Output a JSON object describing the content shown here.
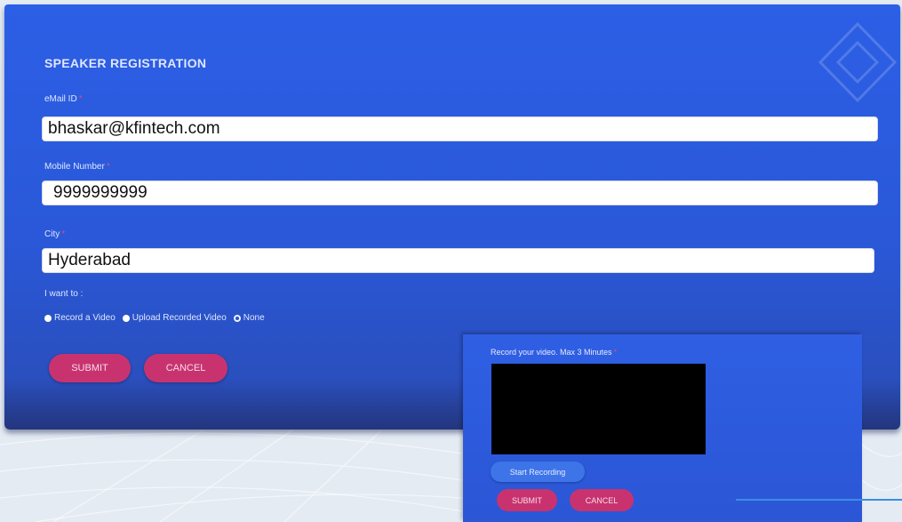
{
  "form": {
    "title": "SPEAKER REGISTRATION",
    "email": {
      "label": "eMail ID",
      "required": "*",
      "value": "bhaskar@kfintech.com"
    },
    "mobile": {
      "label": "Mobile Number",
      "required": "*",
      "value": "9999999999"
    },
    "city": {
      "label": "City",
      "required": "*",
      "value": "Hyderabad"
    },
    "intent_label": "I want to :",
    "options": [
      {
        "label": "Record a Video",
        "selected": false
      },
      {
        "label": "Upload Recorded Video",
        "selected": false
      },
      {
        "label": "None",
        "selected": true
      }
    ],
    "submit_label": "SUBMIT",
    "cancel_label": "CANCEL"
  },
  "recorder": {
    "label": "Record your video. Max 3 Minutes",
    "required": "*",
    "start_label": "Start Recording",
    "submit_label": "SUBMIT",
    "cancel_label": "CANCEL"
  },
  "colors": {
    "panel": "#2c5fe6",
    "button": "#c8336f",
    "required": "#e04a7a"
  }
}
